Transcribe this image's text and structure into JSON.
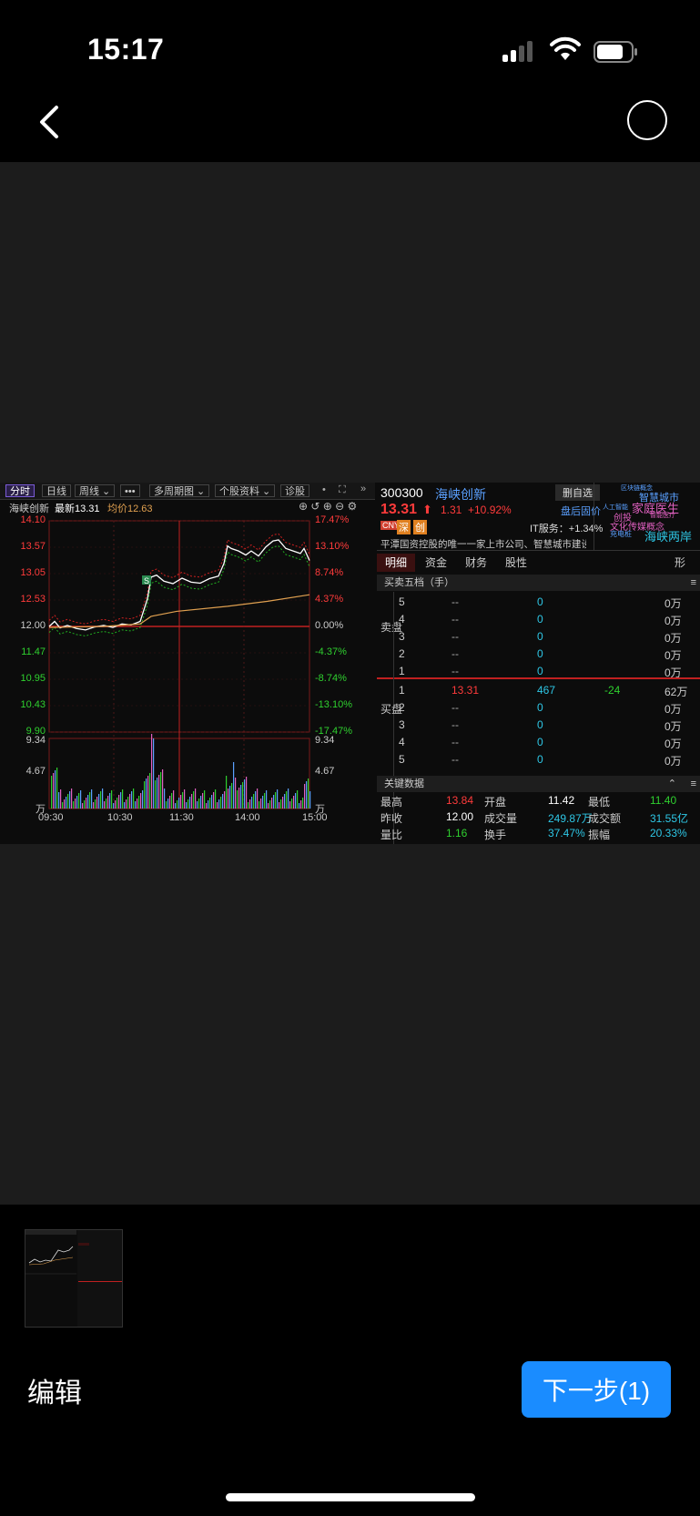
{
  "status": {
    "time": "15:17"
  },
  "footer": {
    "edit_label": "编辑",
    "next_label": "下一步(1)"
  },
  "colors": {
    "accent": "#1a8cff",
    "up": "#ff3b3b",
    "down": "#2fd02f",
    "price_line": "#ffffff",
    "avg_line": "#e0a050",
    "cyan": "#2ec7e6"
  },
  "screenshot": {
    "toolbar": [
      "分时",
      "日线",
      "周线 ⌄",
      "•••",
      "多周期图 ⌄",
      "个股资料 ⌄",
      "诊股",
      "•",
      "⛶",
      "»"
    ],
    "legend": {
      "name": "海峡创新",
      "latest": "最新13.31",
      "avg": "均价12.63"
    },
    "price_axis_left": [
      "14.10",
      "13.57",
      "13.05",
      "12.53",
      "12.00",
      "11.47",
      "10.95",
      "10.43",
      "9.90"
    ],
    "pct_axis_right": [
      "17.47%",
      "13.10%",
      "8.74%",
      "4.37%",
      "0.00%",
      "-4.37%",
      "-8.74%",
      "-13.10%",
      "-17.47%"
    ],
    "vol_axis": [
      "9.34",
      "4.67",
      "万"
    ],
    "time_axis": [
      "09:30",
      "10:30",
      "11:30",
      "14:00",
      "15:00"
    ],
    "marker_s": "S",
    "stock": {
      "code": "300300",
      "name": "海峡创新",
      "add_label": "删自选",
      "price": "13.31",
      "arrow": "⬆",
      "change": "1.31",
      "change_pct": "+10.92%",
      "restore": "盘后固价"
    },
    "badges": [
      "CNY",
      "深",
      "创"
    ],
    "sector": "IT服务：+1.34%",
    "desc": "平潭国资控股的唯一一家上市公司、智慧城市建设...",
    "concepts": [
      "智慧城市",
      "人工智能",
      "家庭医生",
      "创投",
      "智能医疗",
      "文化传媒概念",
      "充电桩",
      "海峡两岸",
      "区块链概念"
    ],
    "tabs": [
      "明细",
      "资金",
      "财务",
      "股性",
      "形"
    ],
    "book_header": "买卖五档（手）",
    "side_sell": "卖盘",
    "side_buy": "买盘",
    "sell_rows": [
      {
        "lvl": "5",
        "price": "--",
        "vol": "0",
        "chg": "",
        "amt": "0万"
      },
      {
        "lvl": "4",
        "price": "--",
        "vol": "0",
        "chg": "",
        "amt": "0万"
      },
      {
        "lvl": "3",
        "price": "--",
        "vol": "0",
        "chg": "",
        "amt": "0万"
      },
      {
        "lvl": "2",
        "price": "--",
        "vol": "0",
        "chg": "",
        "amt": "0万"
      },
      {
        "lvl": "1",
        "price": "--",
        "vol": "0",
        "chg": "",
        "amt": "0万"
      }
    ],
    "buy_rows": [
      {
        "lvl": "1",
        "price": "13.31",
        "vol": "467",
        "chg": "-24",
        "amt": "62万"
      },
      {
        "lvl": "2",
        "price": "--",
        "vol": "0",
        "chg": "",
        "amt": "0万"
      },
      {
        "lvl": "3",
        "price": "--",
        "vol": "0",
        "chg": "",
        "amt": "0万"
      },
      {
        "lvl": "4",
        "price": "--",
        "vol": "0",
        "chg": "",
        "amt": "0万"
      },
      {
        "lvl": "5",
        "price": "--",
        "vol": "0",
        "chg": "",
        "amt": "0万"
      }
    ],
    "key_header": "关键数据",
    "key_rows": [
      [
        {
          "k": "最高",
          "v": "13.84"
        },
        {
          "k": "开盘",
          "v": "11.42"
        },
        {
          "k": "最低",
          "v": "11.40"
        }
      ],
      [
        {
          "k": "昨收",
          "v": "12.00"
        },
        {
          "k": "成交量",
          "v": "249.87万"
        },
        {
          "k": "成交额",
          "v": "31.55亿"
        }
      ],
      [
        {
          "k": "量比",
          "v": "1.16"
        },
        {
          "k": "换手",
          "v": "37.47%"
        },
        {
          "k": "振幅",
          "v": "20.33%"
        }
      ]
    ]
  }
}
